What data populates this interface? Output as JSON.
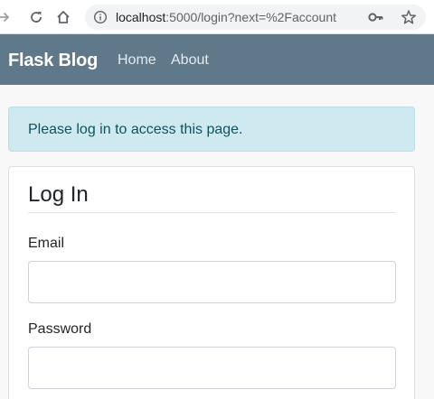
{
  "browser": {
    "url_host": "localhost",
    "url_rest": ":5000/login?next=%2Faccount"
  },
  "navbar": {
    "brand": "Flask Blog",
    "links": [
      {
        "label": "Home"
      },
      {
        "label": "About"
      }
    ]
  },
  "flash": {
    "message": "Please log in to access this page."
  },
  "login_form": {
    "legend": "Log In",
    "email_label": "Email",
    "email_value": "",
    "password_label": "Password",
    "password_value": ""
  },
  "colors": {
    "navbar": "#5f788a",
    "alert_bg": "#cfe9f0",
    "alert_text": "#0f5261"
  }
}
